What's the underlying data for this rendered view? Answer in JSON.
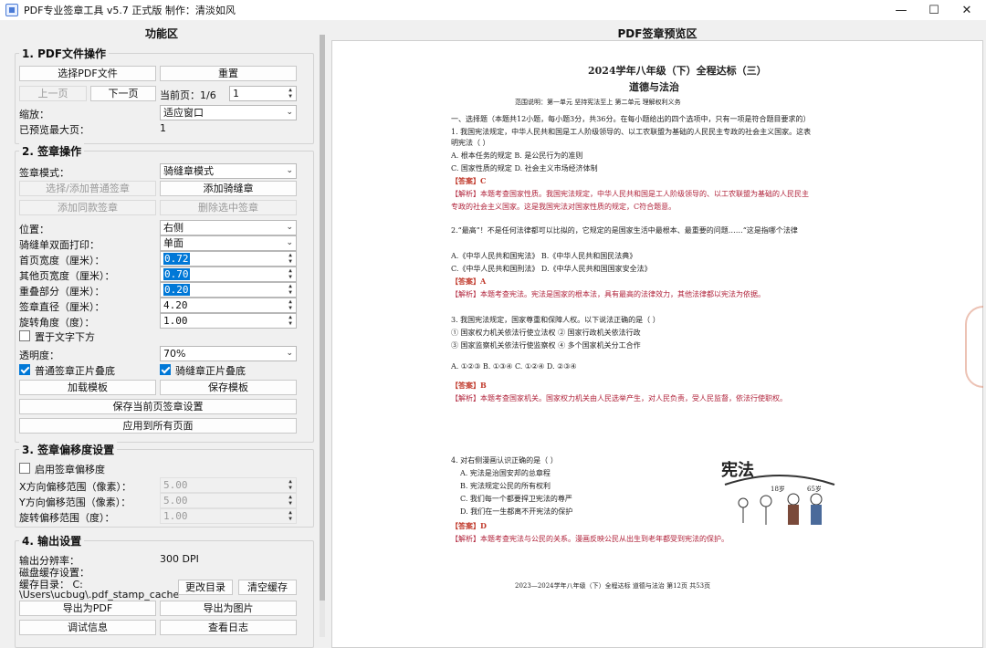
{
  "window": {
    "title": "PDF专业签章工具 v5.7 正式版    制作：清淡如风",
    "controls": {
      "minimize": "—",
      "maximize": "☐",
      "close": "✕"
    }
  },
  "left_panel": {
    "title": "功能区",
    "pdf_ops": {
      "title": "1. PDF文件操作",
      "select_pdf": "选择PDF文件",
      "reset": "重置",
      "prev_page": "上一页",
      "next_page": "下一页",
      "current_page_label": "当前页：1/6",
      "page_value": "1",
      "zoom_label": "缩放：",
      "zoom_value": "适应窗口",
      "max_preview_label": "已预览最大页：",
      "max_preview_value": "1"
    },
    "stamp_ops": {
      "title": "2. 签章操作",
      "mode_label": "签章模式：",
      "mode_value": "骑缝章模式",
      "select_normal": "选择/添加普通签章",
      "add_seam": "添加骑缝章",
      "add_same": "添加同款签章",
      "delete_selected": "删除选中签章",
      "position_label": "位置：",
      "position_value": "右侧",
      "duplex_label": "骑缝单双面打印：",
      "duplex_value": "单面",
      "first_width_label": "首页宽度（厘米）：",
      "first_width_value": "0.72",
      "other_width_label": "其他页宽度（厘米）：",
      "other_width_value": "0.70",
      "overlap_label": "重叠部分（厘米）：",
      "overlap_value": "0.20",
      "diameter_label": "签章直径（厘米）：",
      "diameter_value": "4.20",
      "rotation_label": "旋转角度（度）：",
      "rotation_value": "1.00",
      "below_text_label": "置于文字下方",
      "opacity_label": "透明度：",
      "opacity_value": "70%",
      "normal_overlay_label": "普通签章正片叠底",
      "seam_overlay_label": "骑缝章正片叠底",
      "load_template": "加载模板",
      "save_template": "保存模板",
      "save_current_settings": "保存当前页签章设置",
      "apply_all": "应用到所有页面"
    },
    "offset": {
      "title": "3. 签章偏移度设置",
      "enable_label": "启用签章偏移度",
      "x_label": "X方向偏移范围（像素）：",
      "x_value": "5.00",
      "y_label": "Y方向偏移范围（像素）：",
      "y_value": "5.00",
      "rot_label": "旋转偏移范围（度）：",
      "rot_value": "1.00"
    },
    "output": {
      "title": "4. 输出设置",
      "resolution_label": "输出分辨率：",
      "resolution_value": "300 DPI",
      "disk_cache_label": "磁盘缓存设置：",
      "cache_dir_line1": "缓存目录： C:",
      "cache_dir_line2": "\\Users\\ucbug\\.pdf_stamp_cache",
      "change_dir": "更改目录",
      "clear_cache": "清空缓存",
      "export_pdf": "导出为PDF",
      "export_image": "导出为图片",
      "debug_info": "调试信息",
      "view_log": "查看日志"
    }
  },
  "right_panel": {
    "title": "PDF签章预览区",
    "document": {
      "header": "2024学年八年级（下）全程达标（三）",
      "subject": "道德与法治",
      "scope": "范围说明：第一单元  坚持宪法至上  第二单元  理解权利义务",
      "lines": [
        "一、选择题（本题共12小题，每小题3分，共36分。在每小题给出的四个选项中，只有一项是符合题目要求的）",
        "1. 我国宪法规定，中华人民共和国是工人阶级领导的、以工农联盟为基础的人民民主专政的社会主义国家。这表",
        "明宪法（    ）",
        "A. 根本任务的规定                                    B. 是公民行为的准则",
        "C. 国家性质的规定                                    D. 社会主义市场经济体制",
        "【答案】C",
        "【解析】本题考查国家性质。我国宪法规定，中华人民共和国是工人阶级领导的、以工农联盟为基础的人民民主",
        "专政的社会主义国家。这是我国宪法对国家性质的规定，C符合题意。",
        "2.“最高”！不是任何法律都可以比拟的，它规定的是国家生活中最根本、最重要的问题……“这是指哪个法律",
        "A.《中华人民共和国宪法》                          B.《中华人民共和国民法典》",
        "C.《中华人民共和国刑法》                          D.《中华人民共和国国家安全法》",
        "【答案】A",
        "【解析】本题考查宪法。宪法是国家的根本法，具有最高的法律效力，其他法律都以宪法为依据。",
        "3. 我国宪法规定，国家尊重和保障人权。以下说法正确的是（    ）",
        "① 国家权力机关依法行使立法权    ② 国家行政机关依法行政",
        "③ 国家监察机关依法行使监察权    ④ 多个国家机关分工合作",
        "A. ①②③        B. ①③④        C. ①②④        D. ②③④",
        "【答案】B",
        "【解析】本题考查国家机关。国家权力机关由人民选举产生，对人民负责，受人民监督，依法行使职权。",
        "4. 对右侧漫画认识正确的是（    ）",
        "A. 宪法是治国安邦的总章程",
        "B. 宪法规定公民的所有权利",
        "C. 我们每一个都要捍卫宪法的尊严",
        "D. 我们在一生都离不开宪法的保护",
        "【答案】D",
        "【解析】本题考查宪法与公民的关系。漫画反映公民从出生到老年都受到宪法的保护。",
        "2023—2024学年八年级（下）全程达标  道德与法治  第12页  共53页"
      ],
      "cartoon": {
        "title": "宪法",
        "age_labels": [
          "18岁",
          "65岁"
        ]
      }
    }
  }
}
